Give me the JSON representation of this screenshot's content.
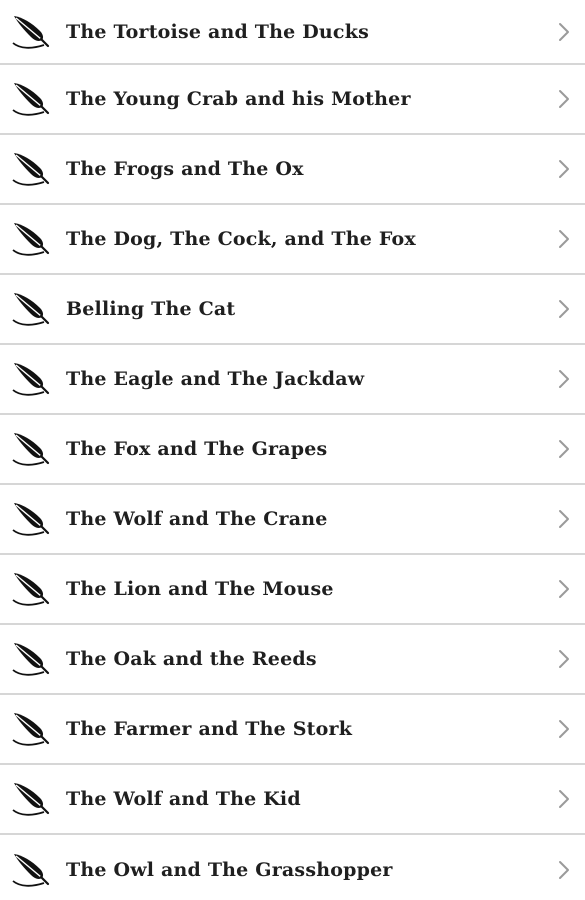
{
  "icons": {
    "row_icon": "quill-feather-icon",
    "row_action": "chevron-right-icon"
  },
  "colors": {
    "text": "#1f1f1f",
    "divider": "#d6d6d6",
    "chevron": "#9a9a9a",
    "icon": "#111111"
  },
  "fables": [
    {
      "title": "The Tortoise and The Ducks"
    },
    {
      "title": "The Young Crab and his Mother"
    },
    {
      "title": "The Frogs and The Ox"
    },
    {
      "title": "The Dog, The Cock, and The Fox"
    },
    {
      "title": "Belling The Cat"
    },
    {
      "title": "The Eagle and The Jackdaw"
    },
    {
      "title": "The Fox and The Grapes"
    },
    {
      "title": "The Wolf and The Crane"
    },
    {
      "title": "The Lion and The Mouse"
    },
    {
      "title": "The Oak and the Reeds"
    },
    {
      "title": "The Farmer and The Stork"
    },
    {
      "title": "The Wolf and The Kid"
    },
    {
      "title": "The Owl and The Grasshopper"
    }
  ]
}
